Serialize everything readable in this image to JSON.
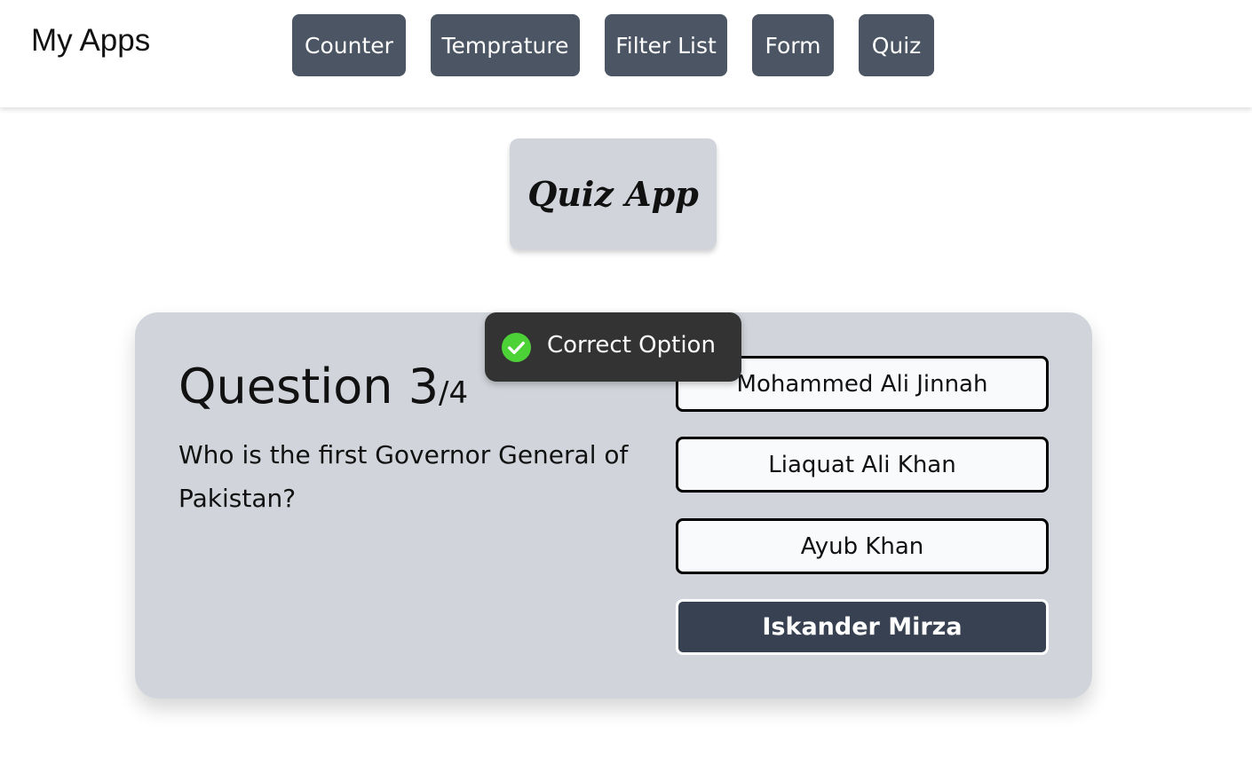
{
  "navbar": {
    "brand": "My Apps",
    "links": [
      "Counter",
      "Temprature",
      "Filter List",
      "Form",
      "Quiz"
    ]
  },
  "header": {
    "title": "Quiz App"
  },
  "quiz": {
    "question_word": "Question 3",
    "question_total": "/4",
    "question_text": "Who is the first Governor General of Pakistan?",
    "options": [
      "Mohammed Ali Jinnah",
      "Liaquat Ali Khan",
      "Ayub Khan",
      "Iskander Mirza"
    ],
    "selected_option": "Iskander Mirza"
  },
  "toast": {
    "message": "Correct Option",
    "icon": "check-circle-icon",
    "icon_color": "#4cd137"
  },
  "colors": {
    "nav_button": "#4b5563",
    "card": "#d1d5db",
    "selected_option": "#374151",
    "toast": "#333333"
  }
}
